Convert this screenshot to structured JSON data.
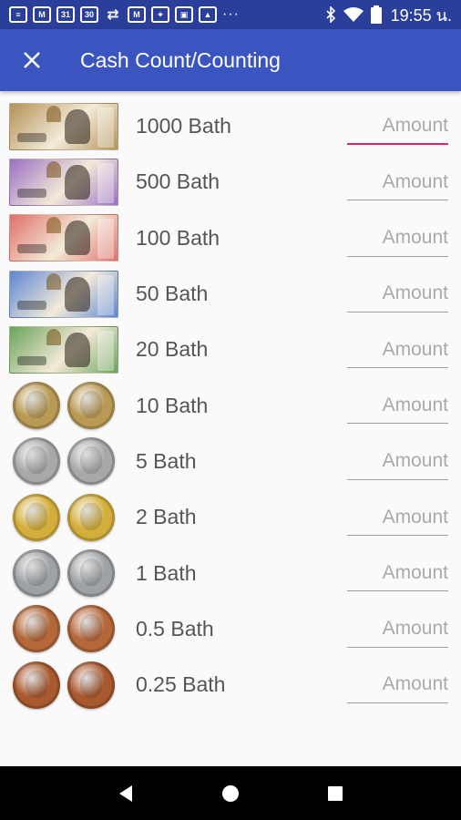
{
  "status_bar": {
    "time": "19:55 น.",
    "left_icons": [
      "document-icon",
      "gmail-icon",
      "calendar-31-icon",
      "calendar-30-icon",
      "sync-icon",
      "gmail-icon",
      "map-icon",
      "wallet-icon",
      "photo-icon"
    ],
    "calendar_31": "31",
    "calendar_30": "30",
    "more": "···"
  },
  "app_bar": {
    "title": "Cash Count/Counting"
  },
  "placeholder": "Amount",
  "colors": {
    "app_bar": "#3a54c0",
    "status_bar": "#2a3f9a",
    "accent": "#e91e63"
  },
  "denominations": [
    {
      "label": "1000 Bath",
      "kind": "note",
      "color": "#b39257"
    },
    {
      "label": "500 Bath",
      "kind": "note",
      "color": "#9b6fc4"
    },
    {
      "label": "100 Bath",
      "kind": "note",
      "color": "#e0706a"
    },
    {
      "label": "50 Bath",
      "kind": "note",
      "color": "#5d86d2"
    },
    {
      "label": "20 Bath",
      "kind": "note",
      "color": "#6aa35a"
    },
    {
      "label": "10 Bath",
      "kind": "coin",
      "color": "#b99a55"
    },
    {
      "label": "5 Bath",
      "kind": "coin",
      "color": "#a8a8a8"
    },
    {
      "label": "2 Bath",
      "kind": "coin",
      "color": "#d4ae3c"
    },
    {
      "label": "1 Bath",
      "kind": "coin",
      "color": "#9fa2a5"
    },
    {
      "label": "0.5 Bath",
      "kind": "coin",
      "color": "#b4683a"
    },
    {
      "label": "0.25 Bath",
      "kind": "coin",
      "color": "#a9592f"
    }
  ]
}
